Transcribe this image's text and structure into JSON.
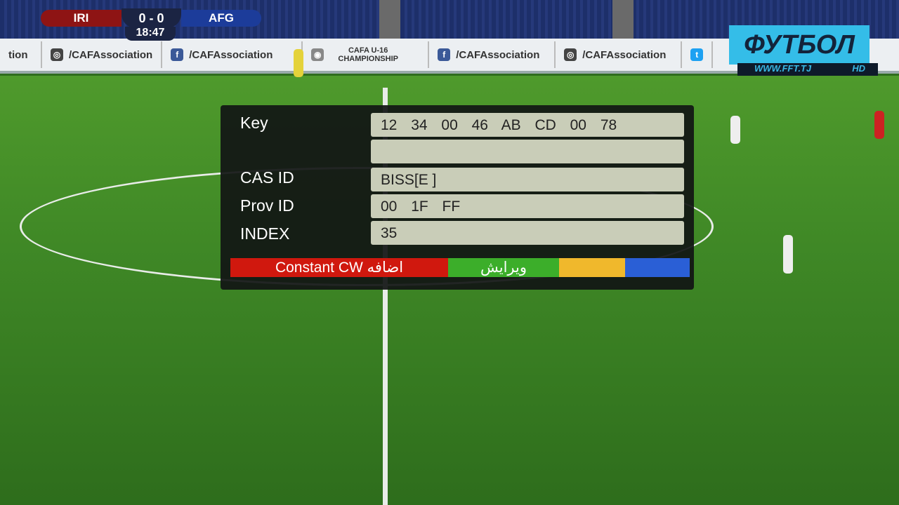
{
  "scoreboard": {
    "home": "IRI",
    "away": "AFG",
    "score": "0 - 0",
    "clock": "18:47"
  },
  "channel_logo": {
    "name": "ФУТБОЛ",
    "url": "WWW.FFT.TJ",
    "quality": "HD"
  },
  "ad_boards": [
    {
      "icon": "instagram-icon",
      "text": "/CAFAssociation"
    },
    {
      "icon": "facebook-icon",
      "text": "/CAFAssociation"
    },
    {
      "icon": "cafa-logo",
      "text": "CAFA U-16 CHAMPIONSHIP"
    },
    {
      "icon": "facebook-icon",
      "text": "/CAFAssociation"
    },
    {
      "icon": "instagram-icon",
      "text": "/CAFAssociation"
    }
  ],
  "osd": {
    "rows": [
      {
        "label": "Key",
        "value": "12 34 00 46 AB CD 00 78"
      },
      {
        "label": "",
        "value": ""
      },
      {
        "label": "CAS ID",
        "value": "BISS[E ]"
      },
      {
        "label": "Prov ID",
        "value": "00 1F FF"
      },
      {
        "label": "INDEX",
        "value": "35"
      }
    ],
    "buttons": [
      {
        "label": "Constant CW اضافه",
        "color": "#d0180e"
      },
      {
        "label": "ویرایش",
        "color": "#3cae2a"
      },
      {
        "label": "",
        "color": "#f0b82c"
      },
      {
        "label": "",
        "color": "#2a5fd6"
      }
    ]
  }
}
